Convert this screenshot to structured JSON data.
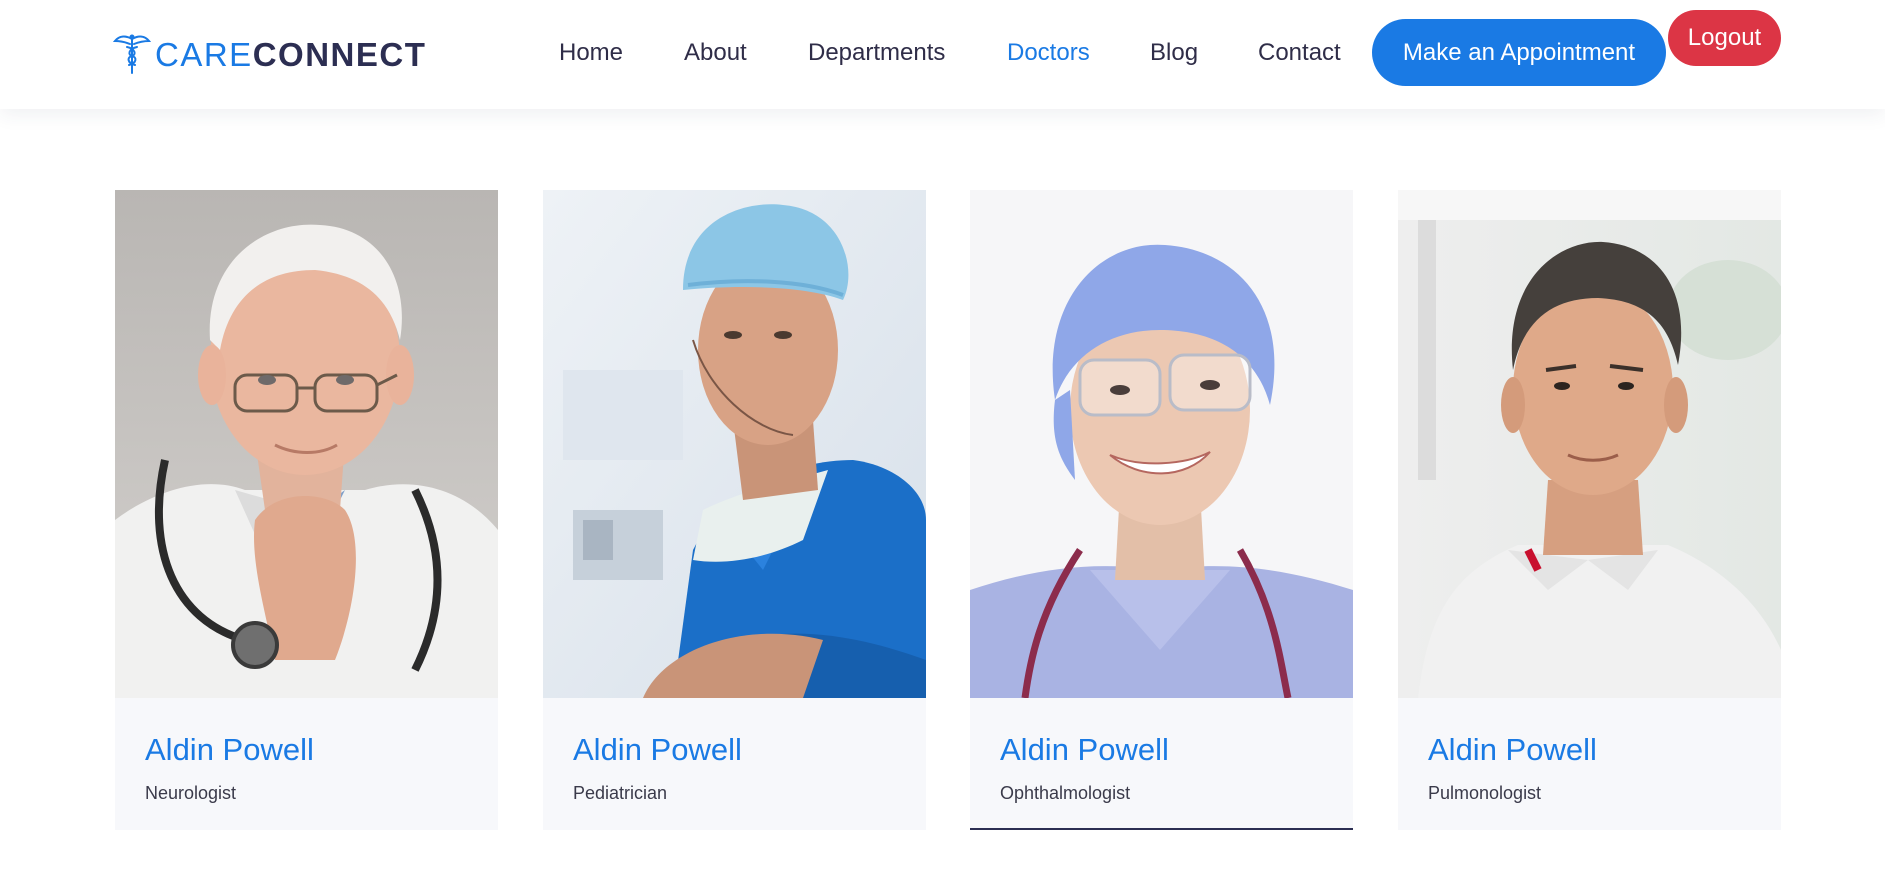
{
  "brand": {
    "name_light": "CARE",
    "name_bold": "CONNECT",
    "icon": "caduceus-icon"
  },
  "nav": [
    {
      "label": "Home",
      "active": false
    },
    {
      "label": "About",
      "active": false
    },
    {
      "label": "Departments",
      "active": false
    },
    {
      "label": "Doctors",
      "active": true
    },
    {
      "label": "Blog",
      "active": false
    },
    {
      "label": "Contact",
      "active": false
    }
  ],
  "actions": {
    "appointment_label": "Make an Appointment",
    "logout_label": "Logout"
  },
  "doctors": [
    {
      "name": "Aldin Powell",
      "specialty": "Neurologist",
      "photo": "senior-doctor-with-stethoscope-photo"
    },
    {
      "name": "Aldin Powell",
      "specialty": "Pediatrician",
      "photo": "surgeon-in-blue-scrubs-photo"
    },
    {
      "name": "Aldin Powell",
      "specialty": "Ophthalmologist",
      "photo": "smiling-doctor-with-cap-and-glasses-photo"
    },
    {
      "name": "Aldin Powell",
      "specialty": "Pulmonologist",
      "photo": "doctor-in-white-polo-photo"
    }
  ],
  "colors": {
    "accent": "#1a7ae4",
    "brand_dark": "#2c2e52",
    "logout": "#dc3545",
    "text": "#2f2d48"
  }
}
